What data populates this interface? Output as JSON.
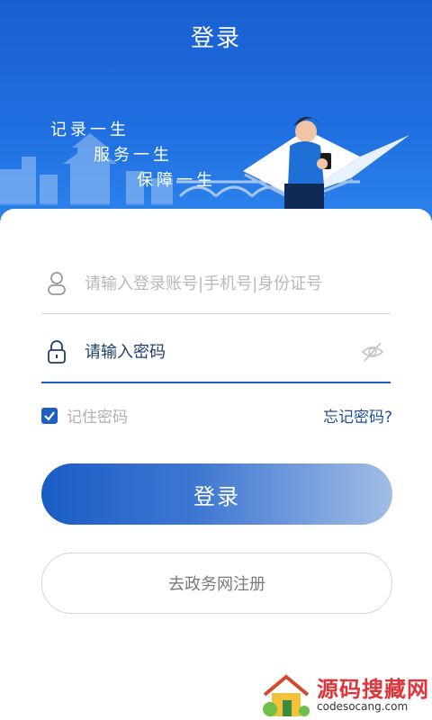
{
  "header": {
    "title": "登录"
  },
  "banner": {
    "slogans": [
      "记录一生",
      "服务一生",
      "保障一生"
    ]
  },
  "form": {
    "username_placeholder": "请输入登录账号|手机号|身份证号",
    "password_placeholder": "请输入密码",
    "remember_label": "记住密码",
    "remember_checked": true,
    "forgot_label": "忘记密码?"
  },
  "buttons": {
    "login_label": "登录",
    "register_label": "去政务网注册"
  },
  "watermark": {
    "title": "源码搜藏网",
    "subtitle": "codesocang.com"
  }
}
